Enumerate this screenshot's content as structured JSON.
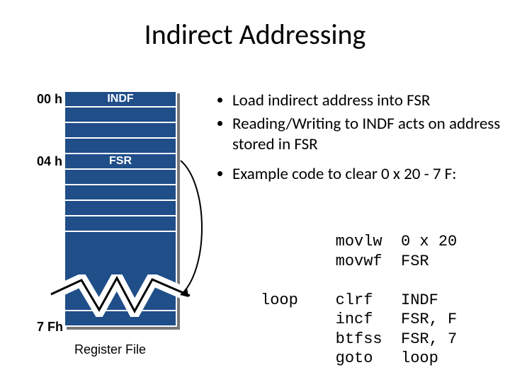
{
  "title": "Indirect Addressing",
  "registers": {
    "addr_00": "00 h",
    "addr_04": "04 h",
    "addr_7f": "7 Fh",
    "indf": "INDF",
    "fsr": "FSR",
    "caption": "Register File"
  },
  "bullets": {
    "b1": "Load indirect address into FSR",
    "b2": "Reading/Writing to INDF acts on address stored in FSR",
    "b3": "Example code to clear 0 x 20 - 7 F:"
  },
  "code": "        movlw  0 x 20\n        movwf  FSR\n\nloop    clrf   INDF\n        incf   FSR, F\n        btfss  FSR, 7\n        goto   loop"
}
